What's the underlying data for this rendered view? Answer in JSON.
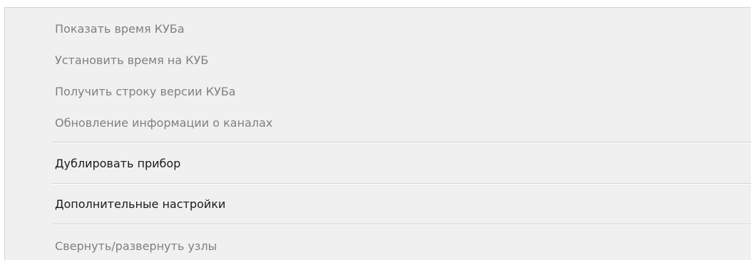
{
  "menu": {
    "group1": [
      {
        "label": "Показать время КУБа",
        "enabled": false
      },
      {
        "label": "Установить время на КУБ",
        "enabled": false
      },
      {
        "label": "Получить строку версии КУБа",
        "enabled": false
      },
      {
        "label": "Обновление информации о каналах",
        "enabled": false
      }
    ],
    "duplicate": {
      "label": "Дублировать прибор",
      "enabled": true
    },
    "advanced": {
      "label": "Дополнительные настройки",
      "enabled": true
    },
    "collapse": {
      "label": "Свернуть/развернуть узлы",
      "enabled": false
    }
  }
}
